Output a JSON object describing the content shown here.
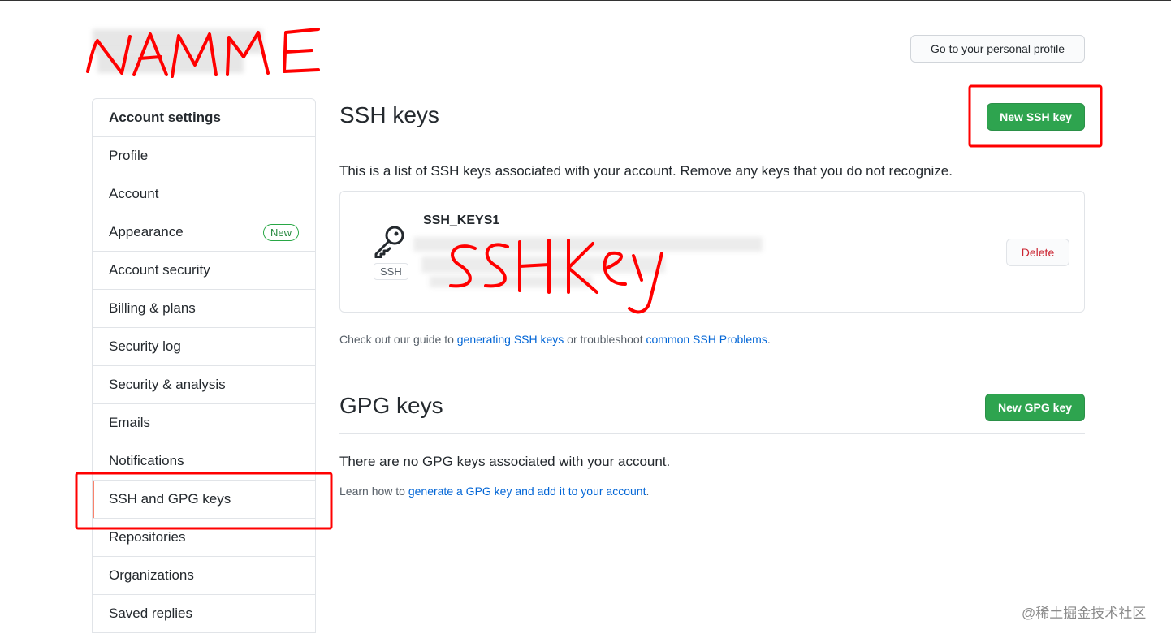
{
  "header": {
    "username_annotation": "NAME",
    "profile_button_label": "Go to your personal profile"
  },
  "sidebar": {
    "heading": "Account settings",
    "items": [
      {
        "label": "Profile"
      },
      {
        "label": "Account"
      },
      {
        "label": "Appearance",
        "badge": "New"
      },
      {
        "label": "Account security"
      },
      {
        "label": "Billing & plans"
      },
      {
        "label": "Security log"
      },
      {
        "label": "Security & analysis"
      },
      {
        "label": "Emails"
      },
      {
        "label": "Notifications"
      },
      {
        "label": "SSH and GPG keys",
        "selected": true
      },
      {
        "label": "Repositories"
      },
      {
        "label": "Organizations"
      },
      {
        "label": "Saved replies"
      }
    ]
  },
  "ssh": {
    "title": "SSH keys",
    "new_button": "New SSH key",
    "description": "This is a list of SSH keys associated with your account. Remove any keys that you do not recognize.",
    "key": {
      "name": "SSH_KEYS1",
      "type_label": "SSH",
      "annotation": "SSH key",
      "delete_label": "Delete"
    },
    "guide": {
      "prefix": "Check out our guide to ",
      "link1": "generating SSH keys",
      "middle": " or troubleshoot ",
      "link2": "common SSH Problems",
      "suffix": "."
    }
  },
  "gpg": {
    "title": "GPG keys",
    "new_button": "New GPG key",
    "empty_message": "There are no GPG keys associated with your account.",
    "learn": {
      "prefix": "Learn how to ",
      "link": "generate a GPG key and add it to your account",
      "suffix": "."
    }
  },
  "watermark": "@稀土掘金技术社区",
  "colors": {
    "primary_green": "#2ea44f",
    "link_blue": "#0366d6",
    "annotation_red": "#ff0000",
    "selected_accent": "#f9826c"
  }
}
